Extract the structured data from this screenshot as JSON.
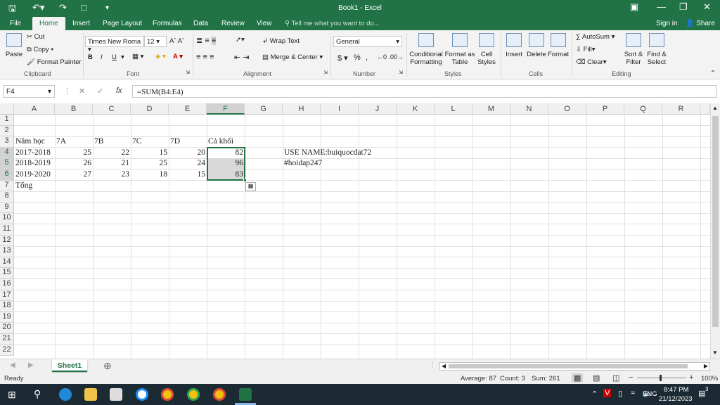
{
  "title": "Book1 - Excel",
  "tabs": [
    "File",
    "Home",
    "Insert",
    "Page Layout",
    "Formulas",
    "Data",
    "Review",
    "View"
  ],
  "active_tab": "Home",
  "tell_me": "Tell me what you want to do...",
  "signin": "Sign in",
  "share": "Share",
  "clipboard": {
    "paste": "Paste",
    "cut": "Cut",
    "copy": "Copy",
    "format_painter": "Format Painter",
    "label": "Clipboard"
  },
  "font": {
    "name": "Times New Roma",
    "size": "12",
    "bold": "B",
    "italic": "I",
    "underline": "U",
    "label": "Font"
  },
  "alignment": {
    "wrap": "Wrap Text",
    "merge": "Merge & Center",
    "label": "Alignment"
  },
  "number": {
    "format": "General",
    "currency": "$",
    "percent": "%",
    "comma": ",",
    "label": "Number"
  },
  "styles": {
    "conditional": "Conditional Formatting",
    "format_table": "Format as Table",
    "cell_styles": "Cell Styles",
    "label": "Styles"
  },
  "cells": {
    "insert": "Insert",
    "delete": "Delete",
    "format": "Format",
    "label": "Cells"
  },
  "editing": {
    "autosum": "AutoSum",
    "fill": "Fill",
    "clear": "Clear",
    "sort": "Sort & Filter",
    "find": "Find & Select",
    "label": "Editing"
  },
  "formula_bar": {
    "name_box": "F4",
    "fx": "fx",
    "formula": "=SUM(B4:E4)"
  },
  "columns": [
    "A",
    "B",
    "C",
    "D",
    "E",
    "F",
    "G",
    "H",
    "I",
    "J",
    "K",
    "L",
    "M",
    "N",
    "O",
    "P",
    "Q",
    "R"
  ],
  "rows": [
    "1",
    "2",
    "3",
    "4",
    "5",
    "6",
    "7",
    "8",
    "9",
    "10",
    "11",
    "12",
    "13",
    "14",
    "15",
    "16",
    "17",
    "18",
    "19",
    "20",
    "21",
    "22"
  ],
  "sheet": {
    "r3": [
      "Năm học",
      "7A",
      "7B",
      "7C",
      "7D",
      "Cả khối"
    ],
    "r4": [
      "2017-2018",
      "25",
      "22",
      "15",
      "20",
      "82"
    ],
    "r5": [
      "2018-2019",
      "26",
      "21",
      "25",
      "24",
      "96"
    ],
    "r6": [
      "2019-2020",
      "27",
      "23",
      "18",
      "15",
      "83"
    ],
    "r7": [
      "Tổng"
    ],
    "h4": "USE NAME:buiquocdat72",
    "h5": "#hoidap247"
  },
  "sheet_tab": "Sheet1",
  "status": {
    "ready": "Ready",
    "average": "Average: 87",
    "count": "Count: 3",
    "sum": "Sum: 261",
    "zoom": "100%"
  },
  "taskbar": {
    "lang": "ENG",
    "time": "8:47 PM",
    "date": "21/12/2023",
    "notif": "3"
  }
}
